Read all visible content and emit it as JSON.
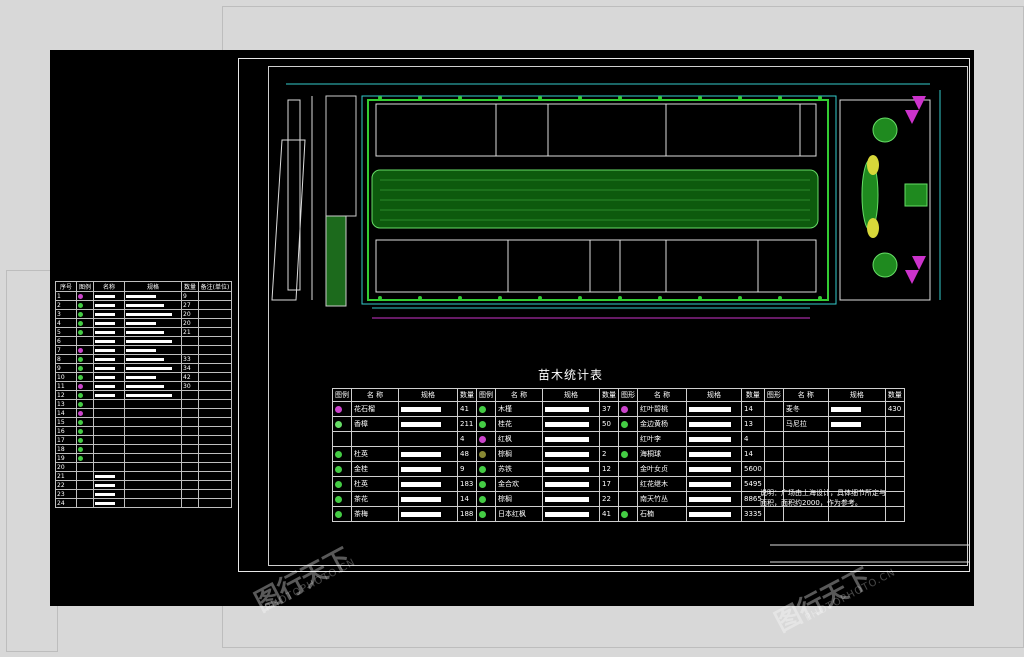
{
  "table_title": "苗木统计表",
  "stat_headers": [
    "图例",
    "名 称",
    "规格",
    "数量",
    "图例",
    "名 称",
    "规格",
    "数量",
    "图形",
    "名 称",
    "规格",
    "数量",
    "图形",
    "名 称",
    "规格",
    "数量"
  ],
  "stat_rows": [
    {
      "c1": "#cc44cc",
      "n1": "花石榴",
      "q1": "41",
      "c2": "#44cc44",
      "n2": "木槿",
      "q2": "37",
      "c3": "#cc44cc",
      "n3": "红叶碧桃",
      "q3": "14",
      "n4": "麦冬",
      "q4": "430"
    },
    {
      "c1": "#66dd66",
      "n1": "香樟",
      "q1": "211",
      "c2": "#44cc44",
      "n2": "桂花",
      "q2": "50",
      "c3": "#44cc44",
      "n3": "金边黄杨",
      "q3": "13",
      "n4": "马尼拉",
      "q4": ""
    },
    {
      "c1": "",
      "n1": "",
      "q1": "4",
      "c2": "#cc44cc",
      "n2": "红枫",
      "q2": "",
      "c3": "",
      "n3": "红叶李",
      "q3": "4",
      "n4": "",
      "q4": ""
    },
    {
      "c1": "#44cc44",
      "n1": "杜英",
      "q1": "48",
      "c2": "#888833",
      "n2": "棕榈",
      "q2": "2",
      "c3": "#44cc44",
      "n3": "海桐球",
      "q3": "14",
      "n4": "",
      "q4": ""
    },
    {
      "c1": "#44cc44",
      "n1": "金桂",
      "q1": "9",
      "c2": "#44cc44",
      "n2": "苏铁",
      "q2": "12",
      "c3": "",
      "n3": "金叶女贞",
      "q3": "5600",
      "n4": "",
      "q4": ""
    },
    {
      "c1": "#44cc44",
      "n1": "杜英",
      "q1": "183",
      "c2": "#44cc44",
      "n2": "金合欢",
      "q2": "17",
      "c3": "",
      "n3": "红花继木",
      "q3": "5495",
      "n4": "",
      "q4": ""
    },
    {
      "c1": "#44cc44",
      "n1": "茶花",
      "q1": "14",
      "c2": "#44cc44",
      "n2": "棕榈",
      "q2": "22",
      "c3": "",
      "n3": "南天竹丛",
      "q3": "8865",
      "n4": "",
      "q4": ""
    },
    {
      "c1": "#44cc44",
      "n1": "茶梅",
      "q1": "188",
      "c2": "#44cc44",
      "n2": "日本红枫",
      "q2": "41",
      "c3": "#44cc44",
      "n3": "石楠",
      "q3": "3335",
      "n4": "",
      "q4": ""
    }
  ],
  "note": "说明：广场由上海设计，具体细节所定与面积，面积约2000，作为参考。",
  "left_headers": [
    "序号",
    "图例",
    "名称",
    "规格",
    "数量",
    "备注(单位)"
  ],
  "left_rows": [
    {
      "no": "1",
      "qty": "9"
    },
    {
      "no": "2",
      "qty": "27"
    },
    {
      "no": "3",
      "qty": "20"
    },
    {
      "no": "4",
      "qty": "20"
    },
    {
      "no": "5",
      "qty": "21"
    },
    {
      "no": "6",
      "qty": ""
    },
    {
      "no": "7",
      "qty": ""
    },
    {
      "no": "8",
      "qty": "33"
    },
    {
      "no": "9",
      "qty": "34"
    },
    {
      "no": "10",
      "qty": "42"
    },
    {
      "no": "11",
      "qty": "30"
    },
    {
      "no": "12",
      "qty": ""
    },
    {
      "no": "13",
      "qty": ""
    },
    {
      "no": "14",
      "qty": ""
    },
    {
      "no": "15",
      "qty": ""
    },
    {
      "no": "16",
      "qty": ""
    },
    {
      "no": "17",
      "qty": ""
    },
    {
      "no": "18",
      "qty": ""
    },
    {
      "no": "19",
      "qty": ""
    },
    {
      "no": "20",
      "qty": ""
    },
    {
      "no": "21",
      "qty": ""
    },
    {
      "no": "22",
      "qty": ""
    },
    {
      "no": "23",
      "qty": ""
    },
    {
      "no": "24",
      "qty": ""
    }
  ],
  "watermark": "图行天下",
  "watermark_url": "PHOTOPHOTO.CN",
  "colors": {
    "background": "#000000",
    "frame": "#e8e8e8",
    "green": "#33cc33",
    "cyan": "#33cccc",
    "magenta": "#cc33cc"
  }
}
